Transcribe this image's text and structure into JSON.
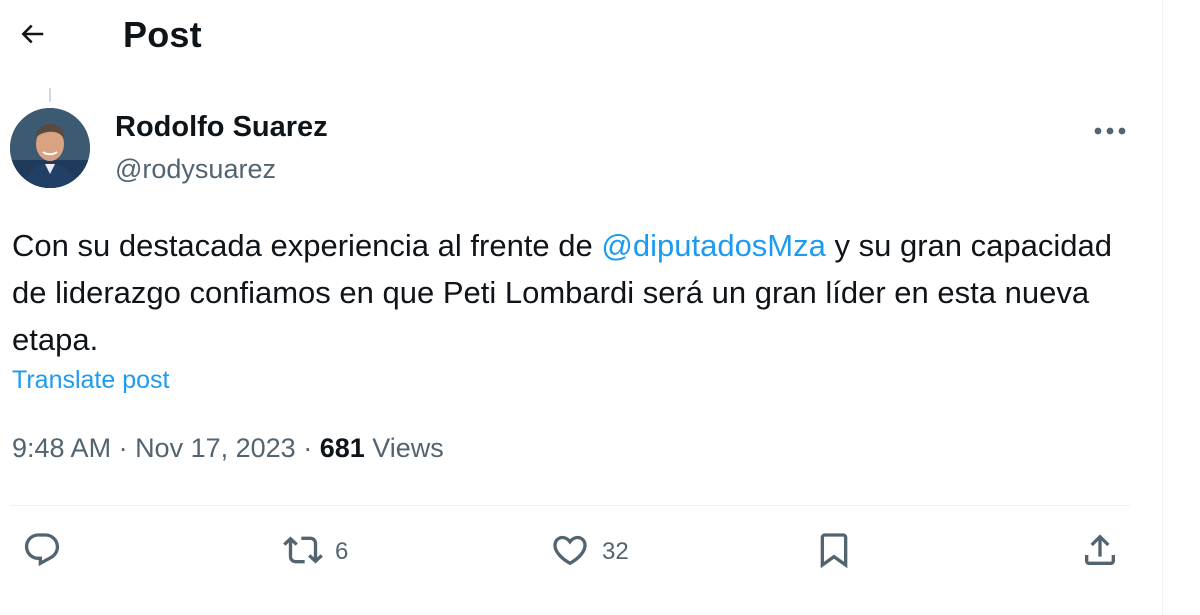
{
  "header": {
    "title": "Post",
    "back_icon": "arrow-left-icon"
  },
  "author": {
    "name": "Rodolfo Suarez",
    "handle": "@rodysuarez"
  },
  "post": {
    "text_part1": "Con su destacada experiencia al frente de ",
    "mention": "@diputadosMza",
    "text_part2": " y su gran capacidad de liderazgo confiamos en que Peti Lombardi será un gran líder en esta nueva etapa.",
    "translate_label": "Translate post"
  },
  "meta": {
    "time": "9:48 AM",
    "separator": " · ",
    "date": "Nov 17, 2023",
    "views_count": "681",
    "views_label": " Views"
  },
  "actions": {
    "reply": {
      "icon": "reply-icon",
      "count": ""
    },
    "repost": {
      "icon": "repost-icon",
      "count": "6"
    },
    "like": {
      "icon": "heart-icon",
      "count": "32"
    },
    "bookmark": {
      "icon": "bookmark-icon"
    },
    "share": {
      "icon": "share-icon"
    }
  },
  "colors": {
    "accent": "#1d9bf0",
    "secondary_text": "#536471",
    "primary_text": "#0f1419",
    "divider": "#eff3f4"
  }
}
